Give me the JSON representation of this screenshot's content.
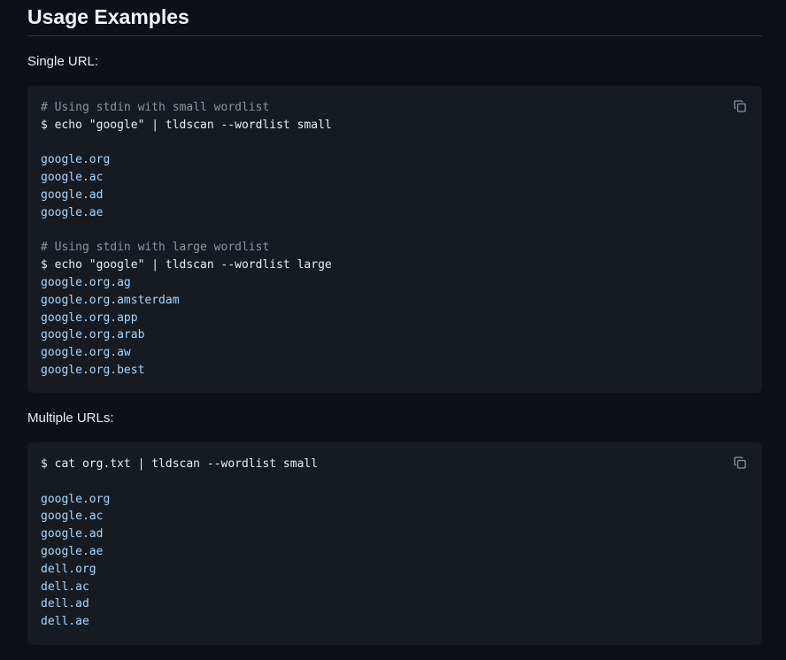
{
  "heading": "Usage Examples",
  "sections": [
    {
      "label": "Single URL:",
      "lines": [
        {
          "kind": "comment",
          "text": "# Using stdin with small wordlist"
        },
        {
          "kind": "cmd",
          "text": "$ echo \"google\" | tldscan --wordlist small"
        },
        {
          "kind": "blank",
          "text": ""
        },
        {
          "kind": "out",
          "text": "google.org"
        },
        {
          "kind": "out",
          "text": "google.ac"
        },
        {
          "kind": "out",
          "text": "google.ad"
        },
        {
          "kind": "out",
          "text": "google.ae"
        },
        {
          "kind": "blank",
          "text": ""
        },
        {
          "kind": "comment",
          "text": "# Using stdin with large wordlist"
        },
        {
          "kind": "cmd",
          "text": "$ echo \"google\" | tldscan --wordlist large"
        },
        {
          "kind": "out",
          "text": "google.org.ag"
        },
        {
          "kind": "out",
          "text": "google.org.amsterdam"
        },
        {
          "kind": "out",
          "text": "google.org.app"
        },
        {
          "kind": "out",
          "text": "google.org.arab"
        },
        {
          "kind": "out",
          "text": "google.org.aw"
        },
        {
          "kind": "out",
          "text": "google.org.best"
        }
      ]
    },
    {
      "label": "Multiple URLs:",
      "lines": [
        {
          "kind": "cmd",
          "text": "$ cat org.txt | tldscan --wordlist small"
        },
        {
          "kind": "blank",
          "text": ""
        },
        {
          "kind": "out",
          "text": "google.org"
        },
        {
          "kind": "out",
          "text": "google.ac"
        },
        {
          "kind": "out",
          "text": "google.ad"
        },
        {
          "kind": "out",
          "text": "google.ae"
        },
        {
          "kind": "out",
          "text": "dell.org"
        },
        {
          "kind": "out",
          "text": "dell.ac"
        },
        {
          "kind": "out",
          "text": "dell.ad"
        },
        {
          "kind": "out",
          "text": "dell.ae"
        }
      ]
    }
  ],
  "icons": {
    "copy": "copy-icon"
  },
  "colors": {
    "background": "#0d1117",
    "code_background": "#161b22",
    "comment": "#8b949e",
    "command": "#e6edf3",
    "output": "#a5d6ff",
    "icon": "#8b949e"
  }
}
